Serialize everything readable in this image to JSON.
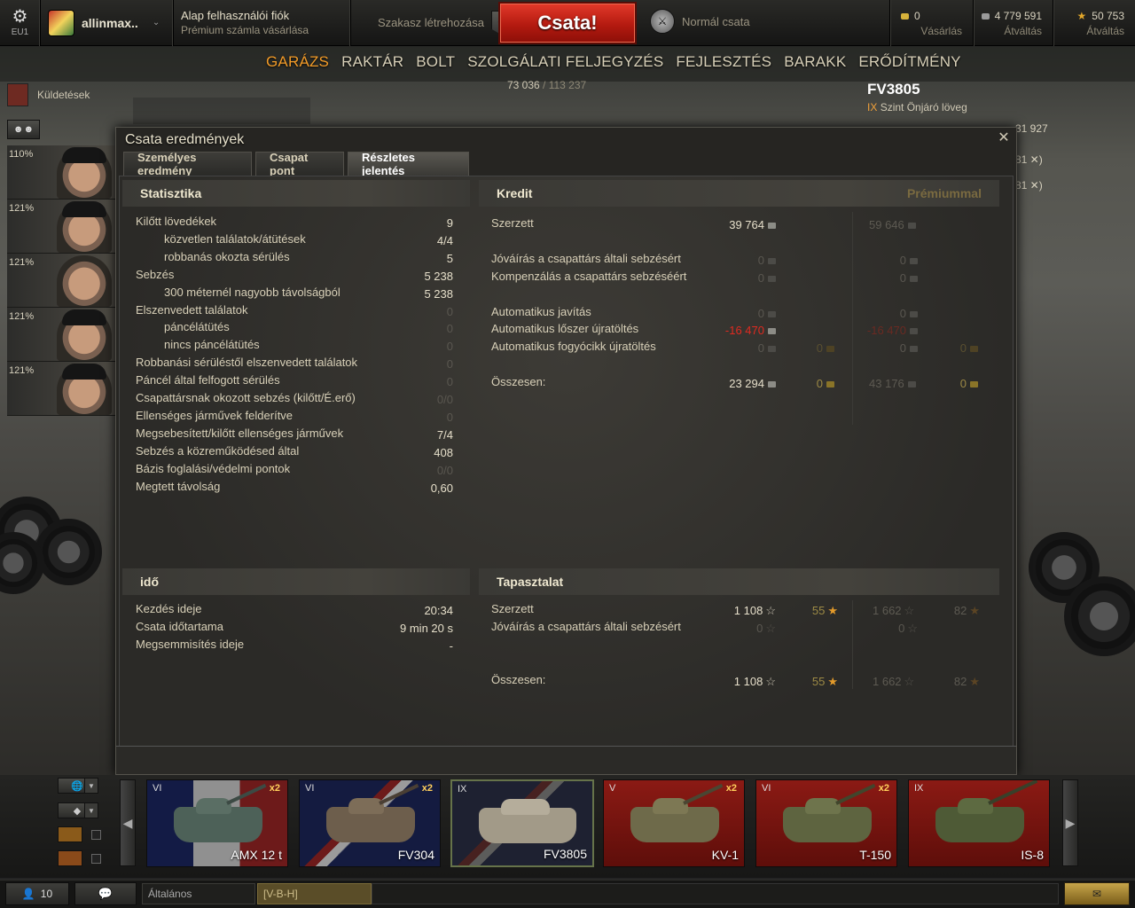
{
  "topbar": {
    "region": "EU1",
    "player_name": "allinmax..",
    "account_line1": "Alap felhasználói fiók",
    "account_line2": "Prémium számla vásárlása",
    "platoon_label": "Szakasz létrehozása",
    "battle_button": "Csata!",
    "mode_label": "Normál csata",
    "gold_value": "0",
    "gold_action": "Vásárlás",
    "credits_value": "4 779 591",
    "credits_action": "Átváltás",
    "xp_value": "50 753",
    "xp_action": "Átváltás"
  },
  "nav": [
    "GARÁZS",
    "RAKTÁR",
    "BOLT",
    "SZOLGÁLATI FELJEGYZÉS",
    "FEJLESZTÉS",
    "BARAKK",
    "ERŐDÍTMÉNY"
  ],
  "research": {
    "current": "73 036",
    "total": "/ 113 237"
  },
  "missions_label": "Küldetések",
  "crew": [
    "110%",
    "121%",
    "121%",
    "121%",
    "121%"
  ],
  "vehicle": {
    "name": "FV3805",
    "tier": "IX",
    "class": "Szint Önjáró löveg"
  },
  "right_numbers": [
    "31 927",
    "81 ✕)",
    "81 ✕)"
  ],
  "dialog": {
    "title": "Csata eredmények",
    "tabs": [
      "Személyes eredmény",
      "Csapat pont",
      "Részletes jelentés"
    ],
    "stats_header": "Statisztika",
    "stats": [
      {
        "label": "Kilőtt lövedékek",
        "value": "9",
        "indent": false,
        "dim": false
      },
      {
        "label": "közvetlen találatok/átütések",
        "value": "4/4",
        "indent": true,
        "dim": false
      },
      {
        "label": "robbanás okozta sérülés",
        "value": "5",
        "indent": true,
        "dim": false
      },
      {
        "label": "Sebzés",
        "value": "5 238",
        "indent": false,
        "dim": false
      },
      {
        "label": "300 méternél nagyobb távolságból",
        "value": "5 238",
        "indent": true,
        "dim": false
      },
      {
        "label": "Elszenvedett találatok",
        "value": "0",
        "indent": false,
        "dim": true
      },
      {
        "label": "páncélátütés",
        "value": "0",
        "indent": true,
        "dim": true
      },
      {
        "label": "nincs páncélátütés",
        "value": "0",
        "indent": true,
        "dim": true
      },
      {
        "label": "Robbanási sérüléstől elszenvedett találatok",
        "value": "0",
        "indent": false,
        "dim": true
      },
      {
        "label": "Páncél által felfogott sérülés",
        "value": "0",
        "indent": false,
        "dim": true
      },
      {
        "label": "Csapattársnak okozott sebzés (kilőtt/É.erő)",
        "value": "0/0",
        "indent": false,
        "dim": true
      },
      {
        "label": "Ellenséges járművek felderítve",
        "value": "0",
        "indent": false,
        "dim": true
      },
      {
        "label": "Megsebesített/kilőtt ellenséges járművek",
        "value": "7/4",
        "indent": false,
        "dim": false
      },
      {
        "label": "Sebzés a közreműködésed által",
        "value": "408",
        "indent": false,
        "dim": false
      },
      {
        "label": "Bázis foglalási/védelmi pontok",
        "value": "0/0",
        "indent": false,
        "dim": true
      },
      {
        "label": "Megtett távolság",
        "value": "0,60",
        "indent": false,
        "dim": false
      }
    ],
    "time_header": "idő",
    "time": [
      {
        "label": "Kezdés ideje",
        "value": "20:34"
      },
      {
        "label": "Csata időtartama",
        "value": "9 min 20 s"
      },
      {
        "label": "Megsemmisítés ideje",
        "value": "-"
      }
    ],
    "credit_header": "Kredit",
    "premium_label": "Prémiummal",
    "credit": {
      "earned_label": "Szerzett",
      "earned": "39 764",
      "earned_prem": "59 646",
      "comp1_label": "Jóváírás a csapattárs általi sebzésért",
      "comp1": "0",
      "comp1_prem": "0",
      "comp2_label": "Kompenzálás a csapattárs sebzéséért",
      "comp2": "0",
      "comp2_prem": "0",
      "repair_label": "Automatikus javítás",
      "repair": "0",
      "repair_prem": "0",
      "ammo_label": "Automatikus lőszer újratöltés",
      "ammo": "-16 470",
      "ammo_prem": "-16 470",
      "cons_label": "Automatikus fogyócikk újratöltés",
      "cons": "0",
      "cons_gold": "0",
      "cons_prem": "0",
      "cons_prem_gold": "0",
      "total_label": "Összesen:",
      "total": "23 294",
      "total_gold": "0",
      "total_prem": "43 176",
      "total_prem_gold": "0"
    },
    "xp_header": "Tapasztalat",
    "xp": {
      "earned_label": "Szerzett",
      "earned": "1 108",
      "free": "55",
      "earned_prem": "1 662",
      "free_prem": "82",
      "comp_label": "Jóváírás a csapattárs általi sebzésért",
      "comp": "0",
      "comp_prem": "0",
      "total_label": "Összesen:",
      "total": "1 108",
      "total_free": "55",
      "total_prem": "1 662",
      "total_free_prem": "82"
    }
  },
  "tanks": [
    {
      "tier": "VI",
      "name": "AMX 12 t",
      "bonus": "x2"
    },
    {
      "tier": "VI",
      "name": "FV304",
      "bonus": "x2"
    },
    {
      "tier": "IX",
      "name": "FV3805",
      "bonus": ""
    },
    {
      "tier": "V",
      "name": "KV-1",
      "bonus": "x2"
    },
    {
      "tier": "VI",
      "name": "T-150",
      "bonus": "x2"
    },
    {
      "tier": "IX",
      "name": "IS-8",
      "bonus": ""
    }
  ],
  "chat": {
    "online": "10",
    "channel": "Általános",
    "input": "[V-B-H]"
  }
}
